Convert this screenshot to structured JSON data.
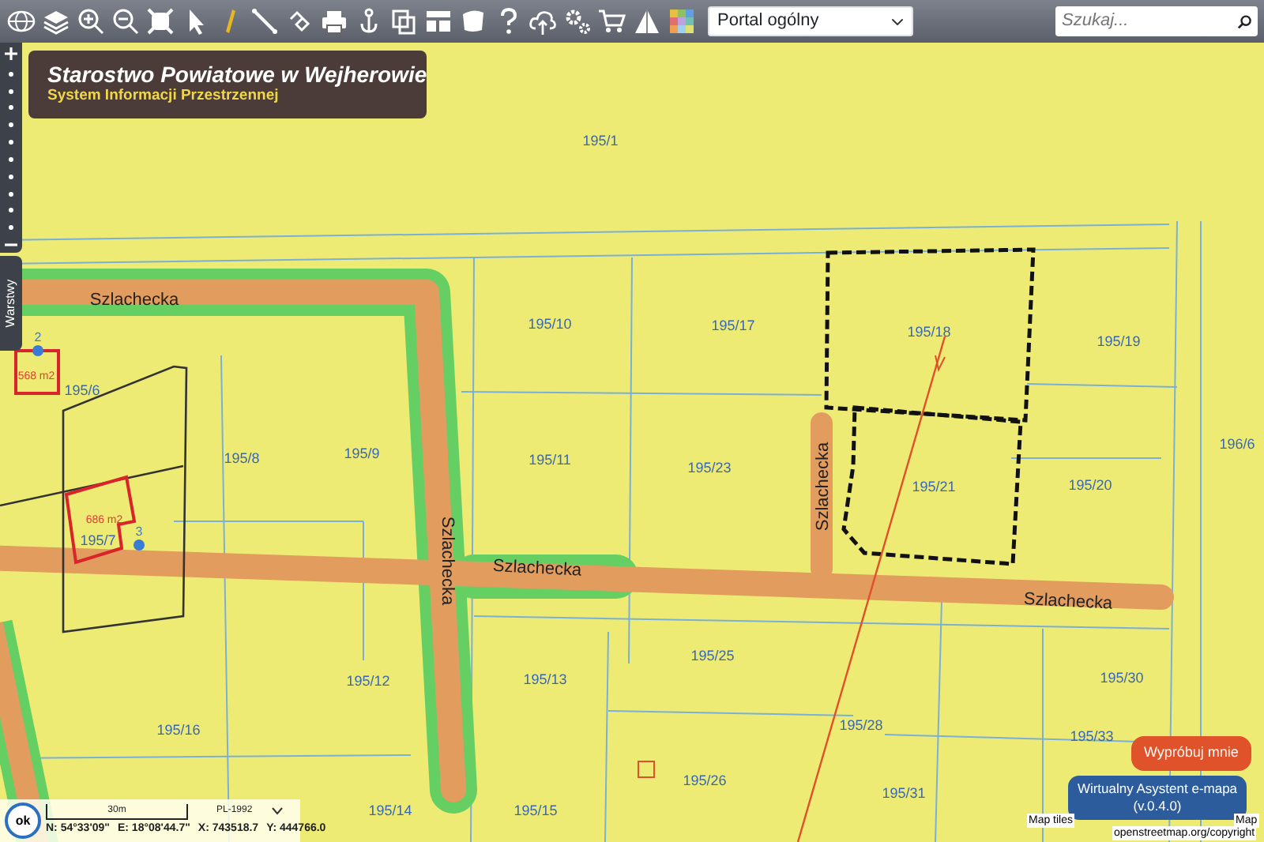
{
  "toolbar": {
    "portal_select": {
      "value": "Portal ogólny"
    },
    "search": {
      "placeholder": "Szukaj..."
    }
  },
  "header": {
    "title": "Starostwo Powiatowe w Wejherowie",
    "subtitle": "System Informacji Przestrzennej"
  },
  "sidebar_tab": {
    "label": "Warstwy"
  },
  "map": {
    "parcels": [
      "195/1",
      "195/10",
      "195/17",
      "195/18",
      "195/19",
      "195/6",
      "195/8",
      "195/9",
      "195/11",
      "195/23",
      "195/21",
      "195/20",
      "196/6",
      "195/7",
      "195/12",
      "195/13",
      "195/25",
      "195/30",
      "195/16",
      "195/28",
      "195/33",
      "195/26",
      "195/31",
      "195/14",
      "195/15"
    ],
    "streets": [
      "Szlachecka",
      "Szlachecka",
      "Szlachecka",
      "Szlachecka",
      "Szlachecka"
    ],
    "areas": [
      "568 m2",
      "686 m2"
    ],
    "markers": [
      "2",
      "3"
    ]
  },
  "scale": {
    "label": "30m",
    "projection": "PL-1992"
  },
  "coordinates": [
    "N: 54°33'09\"",
    "E: 18°08'44.7\"",
    "X: 743518.7",
    "Y: 444766.0"
  ],
  "ok_button": "ok",
  "assistant": {
    "prompt": "Wypróbuj mnie",
    "title": "Wirtualny Asystent e-mapa",
    "version": "(v.0.4.0)"
  },
  "attribution": [
    "Map tiles",
    "Map",
    "openstreetmap.org/copyright"
  ]
}
